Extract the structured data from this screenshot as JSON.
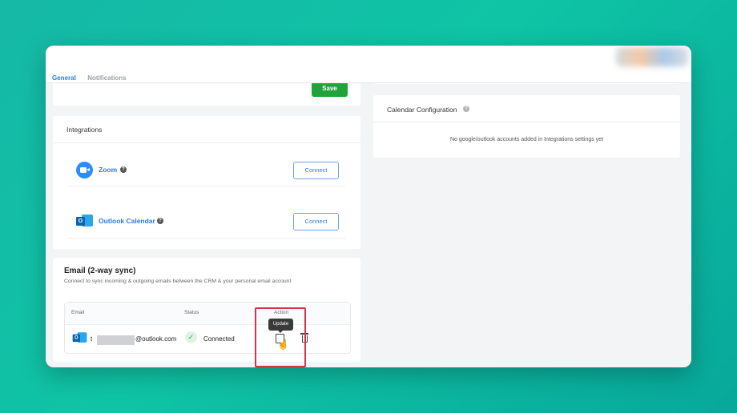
{
  "tabs": [
    "General",
    "Notifications"
  ],
  "save_label": "Save",
  "integrations": {
    "title": "Integrations",
    "items": [
      {
        "name": "Zoom",
        "button": "Connect",
        "icon": "zoom-icon"
      },
      {
        "name": "Outlook Calendar",
        "button": "Connect",
        "icon": "outlook-icon"
      }
    ]
  },
  "email": {
    "title": "Email (2-way sync)",
    "subtitle": "Connect to sync incoming & outgoing emails between the CRM & your personal email account",
    "columns": {
      "email": "Email",
      "status": "Status",
      "action": "Action"
    },
    "row": {
      "email_prefix": "t",
      "email_suffix": "@outlook.com",
      "status": "Connected",
      "tooltip": "Update"
    }
  },
  "calendar": {
    "title": "Calendar Configuration",
    "message": "No google/outlook accounts added in Integrations settings yet"
  },
  "colors": {
    "accent": "#2b7be4",
    "save": "#22a33a",
    "highlight": "#d6334f",
    "background": "#0fc4a5"
  }
}
